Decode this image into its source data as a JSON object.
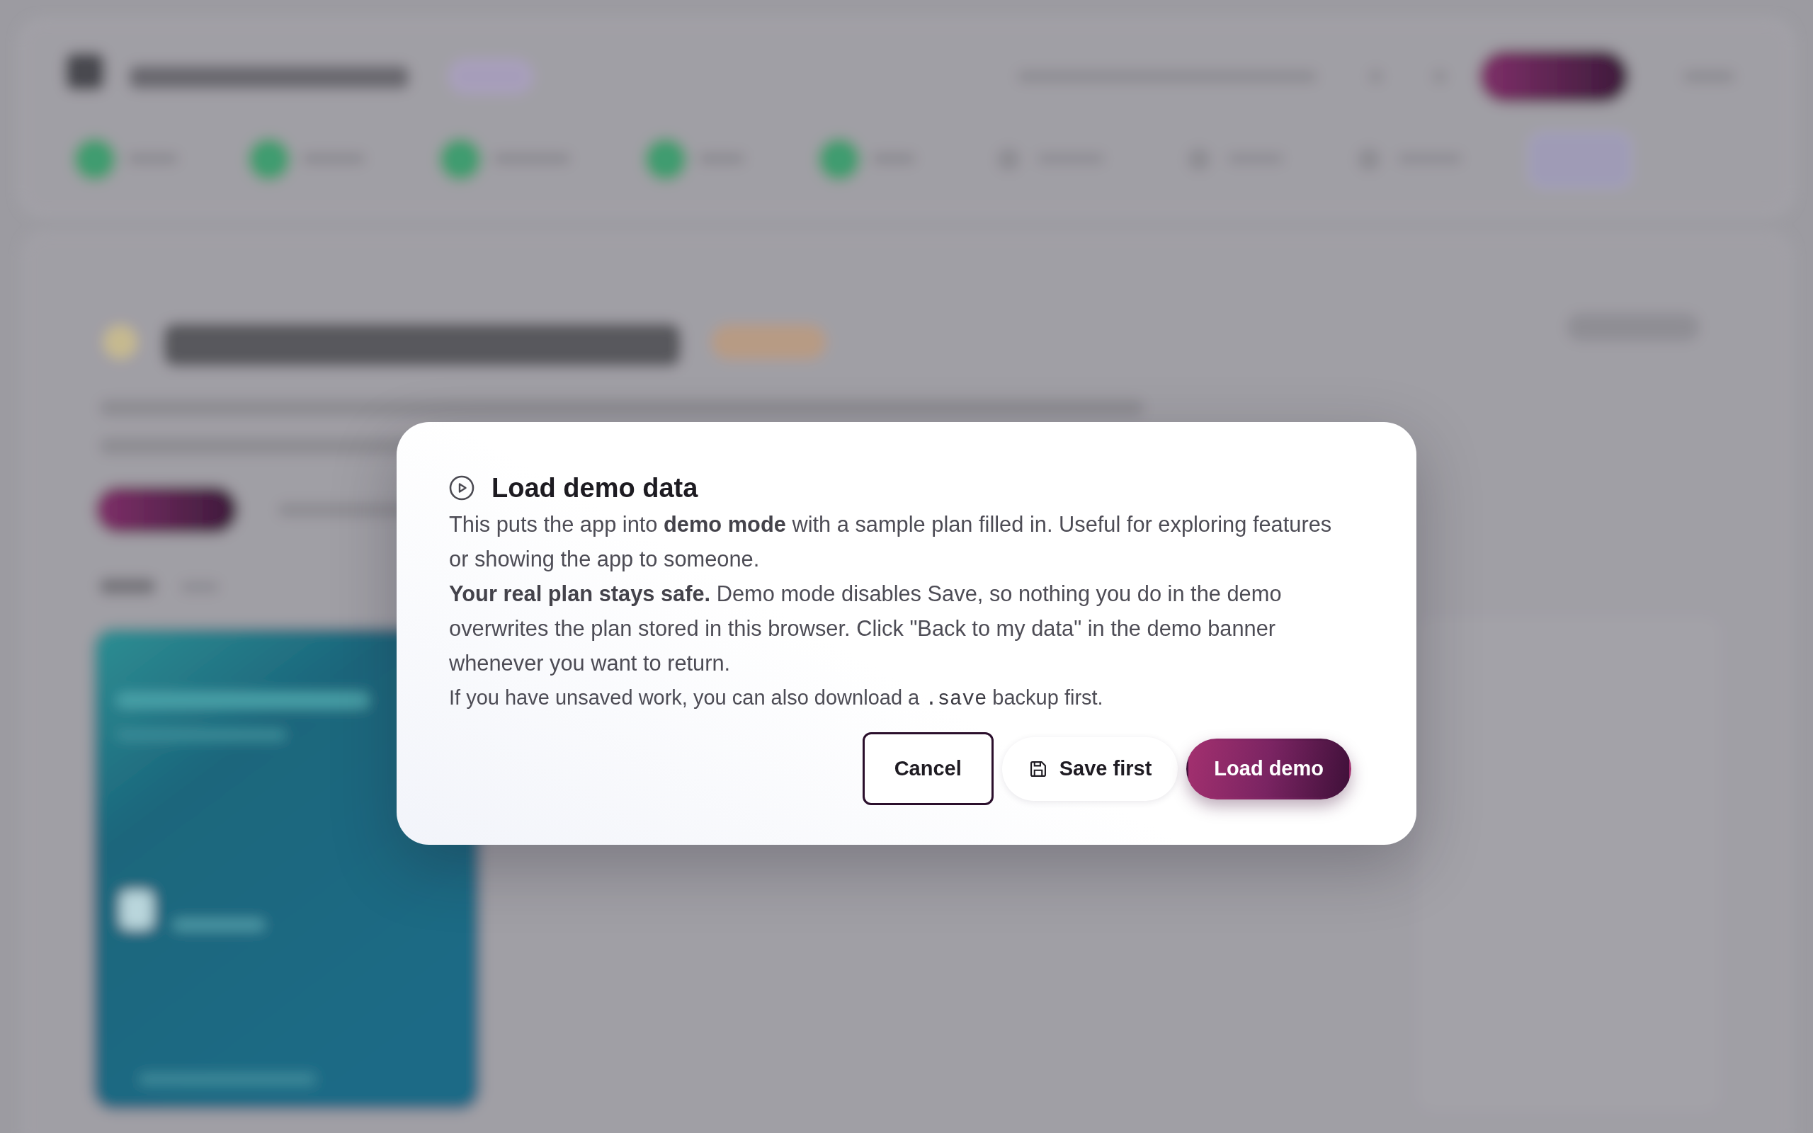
{
  "dialog": {
    "title": "Load demo data",
    "paragraphs": [
      "This puts the app into **demo mode** with a sample plan filled in. Useful for exploring features or showing the app to someone.",
      "**Your real plan stays safe.** Demo mode disables Save, so nothing you do in the demo overwrites the plan stored in this browser. Click \"Back to my data\" in the demo banner whenever you want to return."
    ],
    "note": [
      {
        "kind": "text",
        "text": "If you have unsaved work, you can also download a "
      },
      {
        "kind": "code",
        "text": ".save"
      },
      {
        "kind": "text",
        "text": " backup first."
      }
    ],
    "buttons": [
      {
        "label": "Cancel",
        "kind": "plain",
        "focused": true
      },
      {
        "label": "Save first",
        "kind": "soft",
        "focused": false
      },
      {
        "label": "Load demo",
        "kind": "primary",
        "focused": false
      }
    ]
  }
}
